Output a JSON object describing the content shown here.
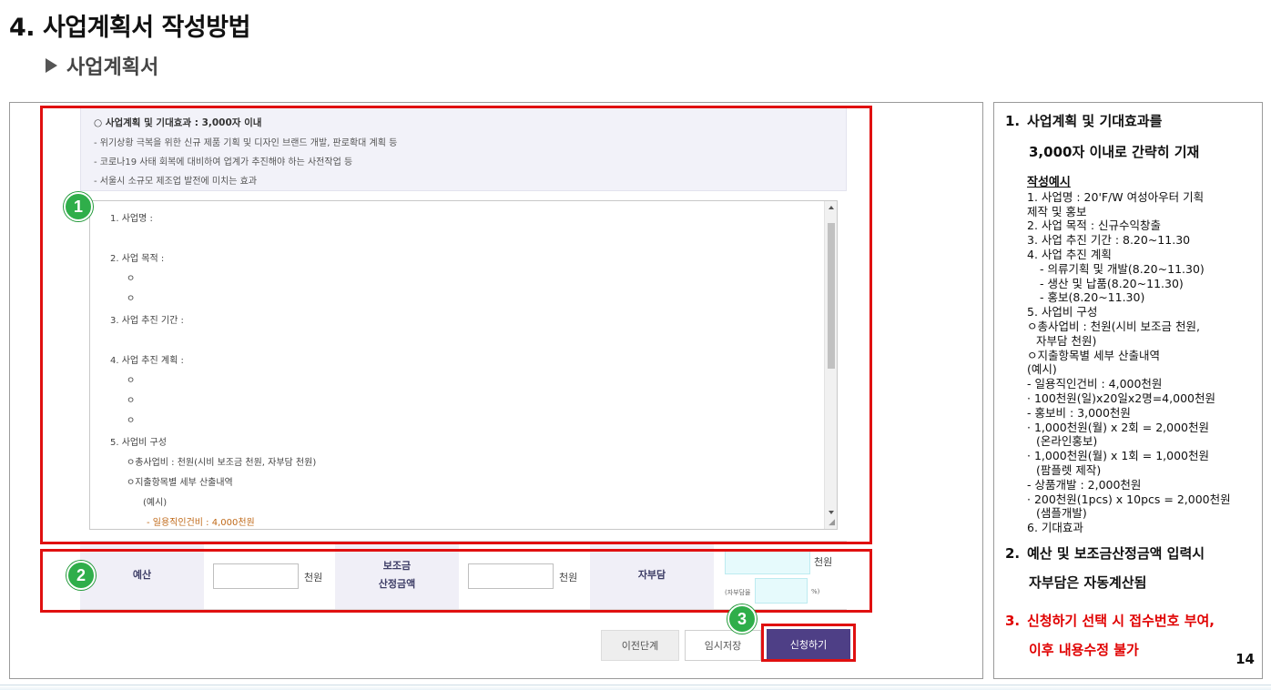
{
  "page": {
    "title": "4. 사업계획서 작성방법",
    "subtitle": "사업계획서"
  },
  "form": {
    "info": {
      "heading": "○ 사업계획 및 기대효과 : 3,000자 이내",
      "lines": [
        "- 위기상황 극복을 위한 신규 제품 기획 및 디자인 브랜드 개발, 판로확대 계획 등",
        "- 코로나19 사태 회복에 대비하여 업계가 추진해야 하는 사전작업 등",
        "- 서울시 소규모 제조업 발전에 미치는 효과"
      ]
    },
    "textarea": {
      "lines": [
        "1. 사업명 :",
        "2. 사업 목적 :",
        "ㅇ",
        "ㅇ",
        "3. 사업 추진 기간 :",
        "4. 사업 추진 계획 :",
        "ㅇ",
        "ㅇ",
        "ㅇ",
        "5. 사업비 구성",
        "ㅇ총사업비 :    천원(시비 보조금    천원, 자부담    천원)",
        "ㅇ지출항목별 세부 산출내역",
        "(예시)",
        "- 일용직인건비 : 4,000천원"
      ]
    },
    "budget": {
      "budget_label": "예산",
      "budget_unit": "천원",
      "subsidy_label_1": "보조금",
      "subsidy_label_2": "산정금액",
      "subsidy_unit": "천원",
      "self_label": "자부담",
      "self_unit": "천원",
      "self_ratio_prefix": "(자부담율",
      "self_ratio_suffix": "%)"
    },
    "buttons": {
      "prev": "이전단계",
      "save": "임시저장",
      "apply": "신청하기"
    },
    "badges": [
      "1",
      "2",
      "3"
    ]
  },
  "panel": {
    "item1_line1": "사업계획 및 기대효과를",
    "item1_line2": "3,000자 이내로 간략히 기재",
    "item1_num": "1.",
    "example_heading": "작성예시",
    "example_lines": [
      "1. 사업명 : 20'F/W 여성아우터 기획",
      "제작 및 홍보",
      "2. 사업 목적 : 신규수익창출",
      "3. 사업 추진 기간 : 8.20~11.30",
      "4. 사업 추진 계획",
      "   - 의류기획 및 개발(8.20~11.30)",
      "   - 생산 및 납품(8.20~11.30)",
      "   - 홍보(8.20~11.30)",
      "5. 사업비 구성",
      "ㅇ총사업비 : 천원(시비 보조금 천원,",
      "   자부담 천원)",
      "ㅇ지출항목별 세부 산출내역",
      "(예시)",
      "- 일용직인건비 : 4,000천원",
      " · 100천원(일)x20일x2명=4,000천원",
      "- 홍보비 : 3,000천원",
      "· 1,000천원(월) x 2회 = 2,000천원",
      "  (온라인홍보)",
      "· 1,000천원(월) x 1회 = 1,000천원",
      "  (팜플렛 제작)",
      "- 상품개발 : 2,000천원",
      "· 200천원(1pcs) x 10pcs = 2,000천원",
      "  (샘플개발)",
      "6. 기대효과"
    ],
    "item2_num": "2.",
    "item2_line1": "예산 및 보조금산정금액 입력시",
    "item2_line2": "자부담은 자동계산됨",
    "item3_num": "3.",
    "item3_line1": "신청하기 선택 시 접수번호 부여,",
    "item3_line2": "이후 내용수정 불가",
    "page_number": "14"
  },
  "colors": {
    "highlight_red": "#e01010",
    "badge_green": "#2fae4a",
    "apply_button": "#4e3f86",
    "label_bg": "#f0eff7",
    "warning_text": "#e00000"
  }
}
